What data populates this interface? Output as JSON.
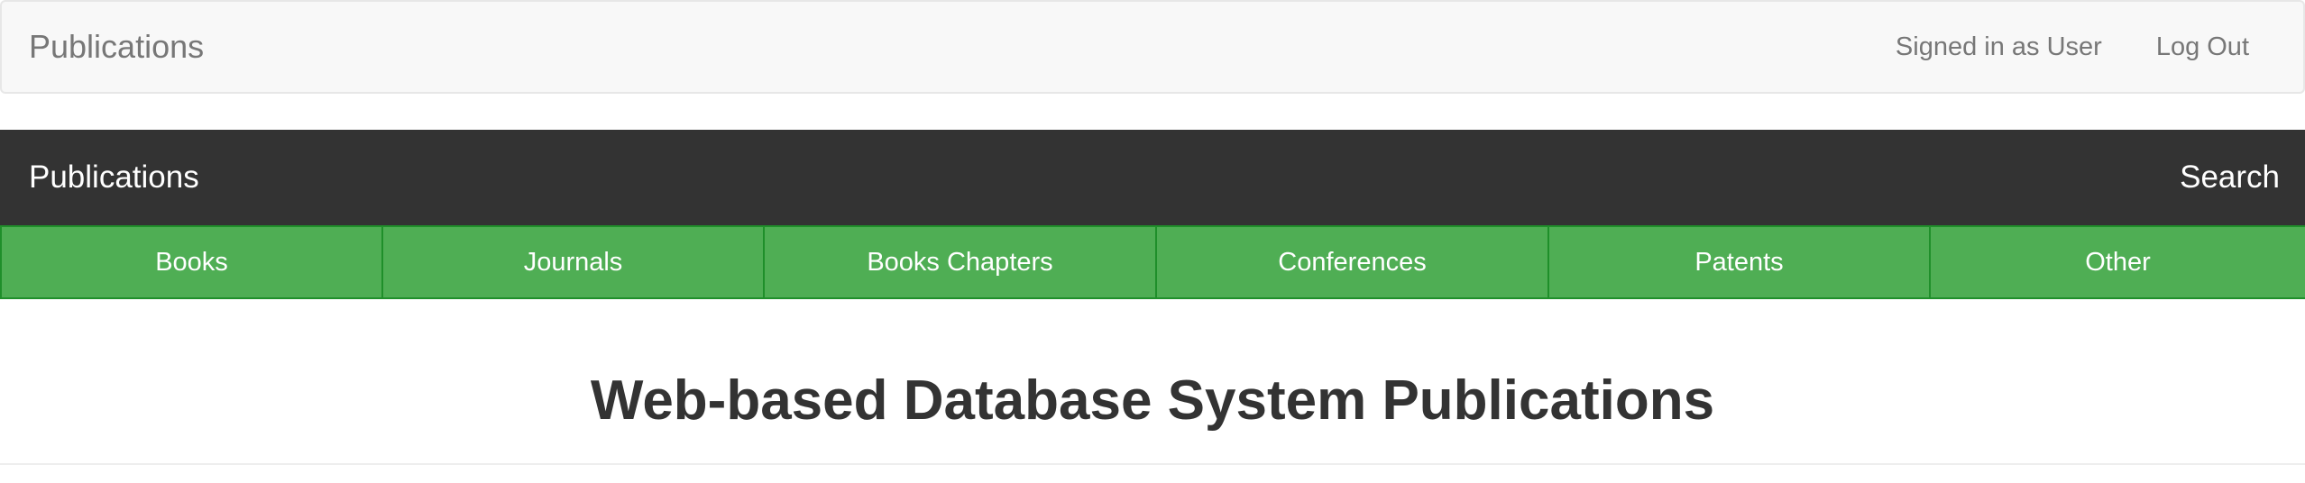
{
  "top_navbar": {
    "brand": "Publications",
    "signed_in": "Signed in as User",
    "logout": "Log Out"
  },
  "dark_bar": {
    "brand": "Publications",
    "search": "Search"
  },
  "nav_tabs": [
    {
      "label": "Books"
    },
    {
      "label": "Journals"
    },
    {
      "label": "Books Chapters"
    },
    {
      "label": "Conferences"
    },
    {
      "label": "Patents"
    },
    {
      "label": "Other"
    }
  ],
  "main": {
    "heading": "Web-based Database System Publications"
  },
  "colors": {
    "dark_bar": "#333333",
    "green_nav": "#4fae54",
    "green_border": "#1f8f2a",
    "top_navbar": "#f8f8f8"
  }
}
